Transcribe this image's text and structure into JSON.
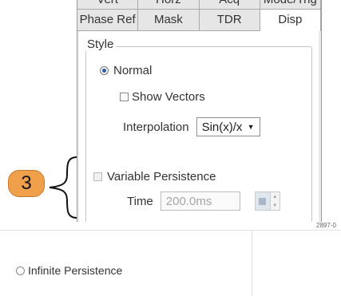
{
  "tabs_top": [
    "Vert",
    "Horz",
    "Acq",
    "Mode/Trig"
  ],
  "tabs": [
    "Phase Ref",
    "Mask",
    "TDR",
    "Disp"
  ],
  "active_tab": "Disp",
  "style_group": {
    "legend": "Style",
    "normal_label": "Normal",
    "normal_selected": true,
    "show_vectors_label": "Show Vectors",
    "show_vectors_checked": false,
    "interpolation_label": "Interpolation",
    "interpolation_value": "Sin(x)/x",
    "variable_persistence_label": "Variable Persistence",
    "variable_persistence_checked": false,
    "time_label": "Time",
    "time_value": "200.0ms"
  },
  "callout_number": "3",
  "figure_id": "2897-0",
  "infinite_persistence_label": "Infinite Persistence",
  "colors": {
    "callout_fill": "#f0a04a",
    "radio_selected": "#2a5ea8",
    "panel_bg": "#ebebeb"
  }
}
